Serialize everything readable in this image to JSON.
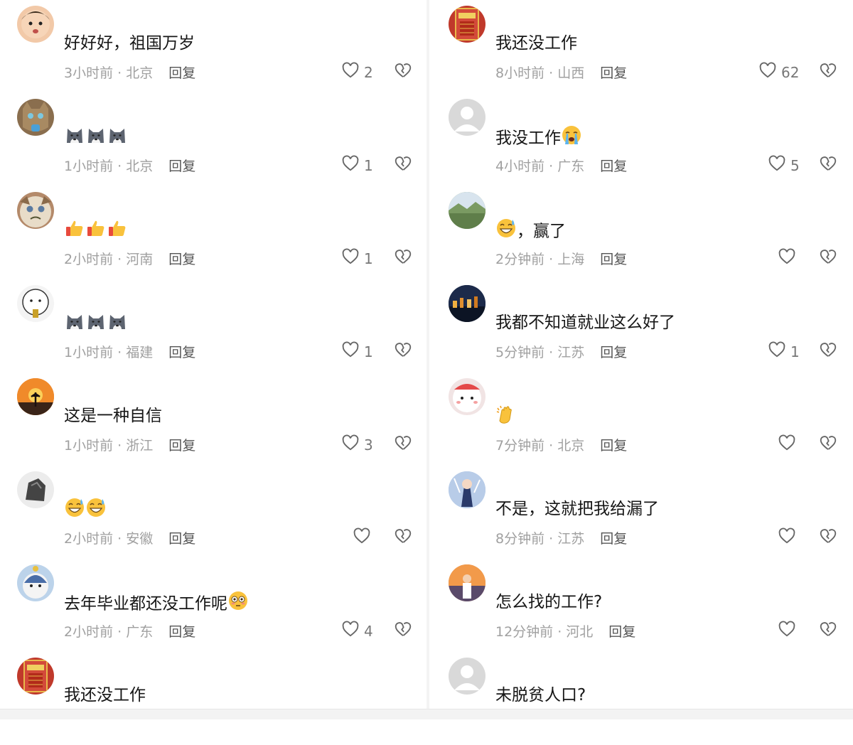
{
  "left_comments": [
    {
      "username": "",
      "text": "好好好，祖国万岁",
      "emoji": [],
      "time": "3小时前",
      "location": "北京",
      "reply": "回复",
      "likes": "2",
      "avatar_icon": "baby-avatar-icon",
      "avatar_color": "#f2c9a8"
    },
    {
      "username": "",
      "text": "",
      "emoji": [
        "husky-emoji",
        "husky-emoji",
        "husky-emoji"
      ],
      "time": "1小时前",
      "location": "北京",
      "reply": "回复",
      "likes": "1",
      "avatar_icon": "cat-avatar-icon",
      "avatar_color": "#8a6e4e"
    },
    {
      "username": "",
      "text": "",
      "emoji": [
        "thumbs-up-emoji",
        "thumbs-up-emoji",
        "thumbs-up-emoji"
      ],
      "time": "2小时前",
      "location": "河南",
      "reply": "回复",
      "likes": "1",
      "avatar_icon": "grumpy-cat-avatar-icon",
      "avatar_color": "#b48a6a"
    },
    {
      "username": "",
      "text": "",
      "emoji": [
        "husky-emoji",
        "husky-emoji",
        "husky-emoji"
      ],
      "time": "1小时前",
      "location": "福建",
      "reply": "回复",
      "likes": "1",
      "avatar_icon": "cartoon-face-avatar-icon",
      "avatar_color": "#f4f4f4"
    },
    {
      "username": "",
      "text": "这是一种自信",
      "emoji": [],
      "time": "1小时前",
      "location": "浙江",
      "reply": "回复",
      "likes": "3",
      "avatar_icon": "sunset-avatar-icon",
      "avatar_color": "#e07a2a"
    },
    {
      "username": "",
      "text": "",
      "emoji": [
        "sweat-grin-emoji",
        "sweat-grin-emoji"
      ],
      "time": "2小时前",
      "location": "安徽",
      "reply": "回复",
      "likes": "",
      "avatar_icon": "rock-avatar-icon",
      "avatar_color": "#ececec"
    },
    {
      "username": "",
      "text": "去年毕业都还没工作呢",
      "emoji": [
        "flushed-emoji"
      ],
      "time": "2小时前",
      "location": "广东",
      "reply": "回复",
      "likes": "4",
      "avatar_icon": "cartoon-boy-avatar-icon",
      "avatar_color": "#bcd3ea"
    },
    {
      "username": "",
      "text": "我还没工作",
      "emoji": [],
      "time": "",
      "location": "",
      "reply": "",
      "likes": "",
      "avatar_icon": "red-poster-avatar-icon",
      "avatar_color": "#c0392b"
    }
  ],
  "right_comments": [
    {
      "username": "",
      "text": "我还没工作",
      "emoji": [],
      "time": "8小时前",
      "location": "山西",
      "reply": "回复",
      "likes": "62",
      "avatar_icon": "red-poster-avatar-icon",
      "avatar_color": "#c0392b"
    },
    {
      "username": "",
      "text": "我没工作",
      "emoji": [
        "crying-emoji"
      ],
      "time": "4小时前",
      "location": "广东",
      "reply": "回复",
      "likes": "5",
      "avatar_icon": "default-avatar-icon",
      "avatar_color": "#d9d9d9"
    },
    {
      "username": "",
      "text": "，赢了",
      "emoji_before": [
        "sweat-grin-emoji"
      ],
      "emoji": [],
      "time": "2分钟前",
      "location": "上海",
      "reply": "回复",
      "likes": "",
      "avatar_icon": "landscape-avatar-icon",
      "avatar_color": "#7a9a6a"
    },
    {
      "username": "",
      "text": "我都不知道就业这么好了",
      "emoji": [],
      "time": "5分钟前",
      "location": "江苏",
      "reply": "回复",
      "likes": "1",
      "avatar_icon": "night-city-avatar-icon",
      "avatar_color": "#1d2c4a"
    },
    {
      "username": "",
      "text": "",
      "emoji": [
        "clapping-emoji"
      ],
      "time": "7分钟前",
      "location": "北京",
      "reply": "回复",
      "likes": "",
      "avatar_icon": "plush-avatar-icon",
      "avatar_color": "#f1e4e4"
    },
    {
      "username": "",
      "text": "不是，这就把我给漏了",
      "emoji": [],
      "time": "8分钟前",
      "location": "江苏",
      "reply": "回复",
      "likes": "",
      "avatar_icon": "anime-avatar-icon",
      "avatar_color": "#a9c4e6"
    },
    {
      "username": "",
      "text": "怎么找的工作?",
      "emoji": [],
      "time": "12分钟前",
      "location": "河北",
      "reply": "回复",
      "likes": "",
      "avatar_icon": "sunset-person-avatar-icon",
      "avatar_color": "#d9874a"
    },
    {
      "username": "",
      "text": "未脱贫人口?",
      "emoji": [],
      "time": "",
      "location": "",
      "reply": "",
      "likes": "",
      "avatar_icon": "default-avatar-icon",
      "avatar_color": "#d9d9d9"
    }
  ],
  "separator": " · "
}
